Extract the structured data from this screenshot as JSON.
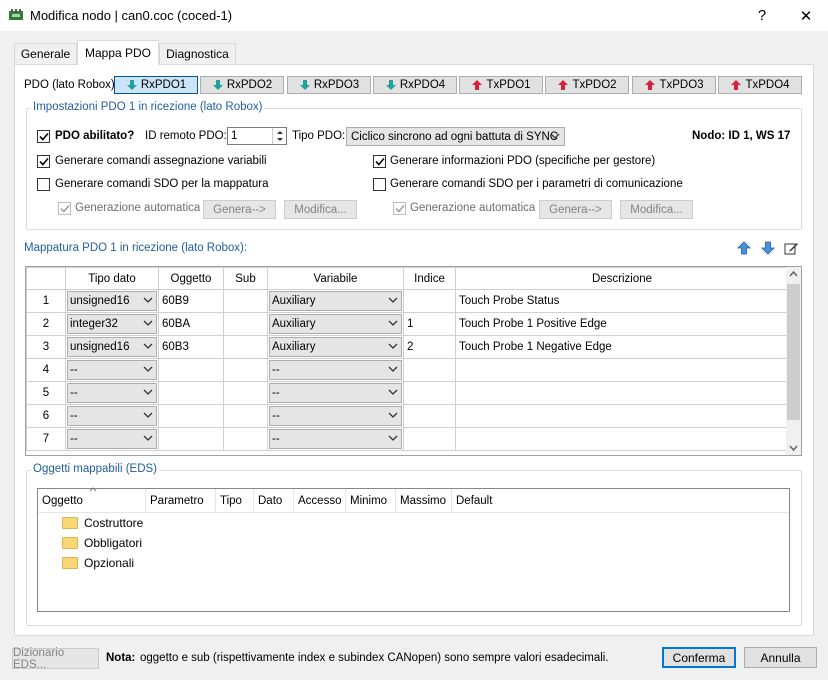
{
  "window": {
    "title": "Modifica nodo | can0.coc (coced-1)",
    "help": "?",
    "close": "✕"
  },
  "tabs": [
    {
      "label": "Generale"
    },
    {
      "label": "Mappa PDO",
      "active": true
    },
    {
      "label": "Diagnostica"
    }
  ],
  "pdo_bar": {
    "label": "PDO (lato Robox):",
    "buttons": [
      {
        "label": "RxPDO1",
        "kind": "rx",
        "active": true
      },
      {
        "label": "RxPDO2",
        "kind": "rx"
      },
      {
        "label": "RxPDO3",
        "kind": "rx"
      },
      {
        "label": "RxPDO4",
        "kind": "rx"
      },
      {
        "label": "TxPDO1",
        "kind": "tx"
      },
      {
        "label": "TxPDO2",
        "kind": "tx"
      },
      {
        "label": "TxPDO3",
        "kind": "tx"
      },
      {
        "label": "TxPDO4",
        "kind": "tx"
      }
    ]
  },
  "settings": {
    "legend": "Impostazioni PDO 1 in ricezione (lato Robox)",
    "enabled_label": "PDO abilitato?",
    "remote_id_label": "ID remoto PDO:",
    "remote_id_value": "1",
    "pdo_type_label": "Tipo PDO:",
    "pdo_type_value": "Ciclico sincrono ad ogni battuta di SYNC",
    "node_info": "Nodo: ID 1, WS 17",
    "gen_var_assign": "Generare comandi assegnazione variabili",
    "gen_pdo_info": "Generare informazioni PDO (specifiche per gestore)",
    "gen_sdo_mapping": "Generare comandi SDO per la mappatura",
    "gen_sdo_comm": "Generare comandi SDO per i parametri di comunicazione",
    "auto_gen": "Generazione automatica",
    "genera_btn": "Genera-->",
    "modifica_btn": "Modifica..."
  },
  "mapping": {
    "title": "Mappatura PDO 1 in ricezione (lato Robox):",
    "columns": [
      "Tipo dato",
      "Oggetto",
      "Sub",
      "Variabile",
      "Indice",
      "Descrizione"
    ],
    "rows": [
      {
        "n": "1",
        "tipo": "unsigned16",
        "oggetto": "60B9",
        "sub": "",
        "variabile": "Auxiliary",
        "indice": "",
        "descrizione": "Touch Probe Status"
      },
      {
        "n": "2",
        "tipo": "integer32",
        "oggetto": "60BA",
        "sub": "",
        "variabile": "Auxiliary",
        "indice": "1",
        "descrizione": "Touch Probe 1 Positive Edge"
      },
      {
        "n": "3",
        "tipo": "unsigned16",
        "oggetto": "60B3",
        "sub": "",
        "variabile": "Auxiliary",
        "indice": "2",
        "descrizione": "Touch Probe 1 Negative Edge"
      },
      {
        "n": "4",
        "tipo": "--",
        "oggetto": "",
        "sub": "",
        "variabile": "--",
        "indice": "",
        "descrizione": ""
      },
      {
        "n": "5",
        "tipo": "--",
        "oggetto": "",
        "sub": "",
        "variabile": "--",
        "indice": "",
        "descrizione": ""
      },
      {
        "n": "6",
        "tipo": "--",
        "oggetto": "",
        "sub": "",
        "variabile": "--",
        "indice": "",
        "descrizione": ""
      },
      {
        "n": "7",
        "tipo": "--",
        "oggetto": "",
        "sub": "",
        "variabile": "--",
        "indice": "",
        "descrizione": ""
      }
    ]
  },
  "eds": {
    "legend": "Oggetti mappabili (EDS)",
    "columns": [
      "Oggetto",
      "Parametro",
      "Tipo",
      "Dato",
      "Accesso",
      "Minimo",
      "Massimo",
      "Default"
    ],
    "folders": [
      "Costruttore",
      "Obbligatori",
      "Opzionali"
    ]
  },
  "footer": {
    "eds_dict_btn": "Dizionario EDS...",
    "note_bold": "Nota:",
    "note_text": "oggetto e sub (rispettivamente index e subindex CANopen) sono sempre valori esadecimali.",
    "confirm_btn": "Conferma",
    "cancel_btn": "Annulla"
  },
  "colors": {
    "accent": "#1f5f9f",
    "rx_arrow": "#21a0a0",
    "tx_arrow": "#d9203a",
    "active_button": "#cce4f7"
  }
}
